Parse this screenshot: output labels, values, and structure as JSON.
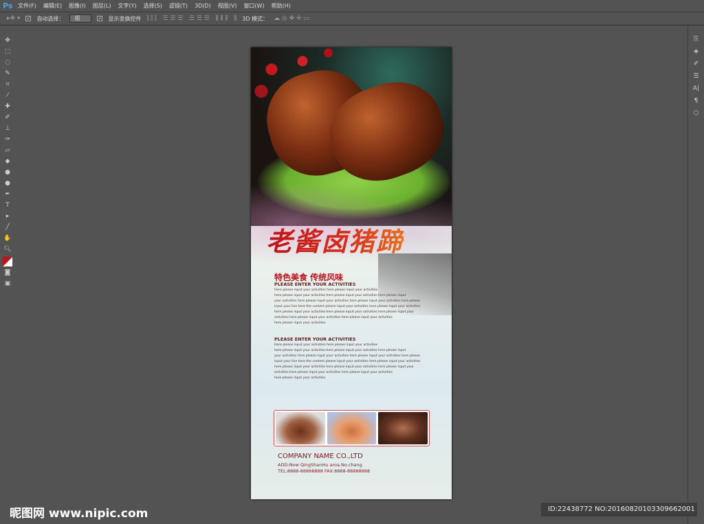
{
  "app": {
    "logo": "Ps"
  },
  "menu": [
    "文件(F)",
    "编辑(E)",
    "图像(I)",
    "图层(L)",
    "文字(Y)",
    "选择(S)",
    "滤镜(T)",
    "3D(D)",
    "视图(V)",
    "窗口(W)",
    "帮助(H)"
  ],
  "options": {
    "auto_select_label": "自动选择：",
    "auto_select_value": "组",
    "show_transform_label": "显示变换控件",
    "mode_3d_label": "3D 模式："
  },
  "poster": {
    "title": "老酱卤猪蹄",
    "subtitle": "特色美食 传统风味",
    "heading1": "PLEASE ENTER YOUR ACTIVITIES",
    "para1": [
      "Here please input your activities here please input your activities",
      "here please input your activities here please input your activities here please input",
      "your activities here please input your activities here please input your activities here please",
      "input your live here the content please input your activities here please input your activities",
      "here please input your activities here please input your activities here please input your",
      " activities here please input your activities here please input your activities",
      "here please input your activities"
    ],
    "heading2": "PLEASE ENTER YOUR ACTIVITIES",
    "para2": [
      "Here please input your activities here please input your activities",
      "here please input your activities here please input your activities here please input",
      "your activities here please input your activities here please input your activities here please",
      "input your live here the content please input your activities here please input your activities",
      "here please input your activities here please input your activities here please input your",
      " activities here please input your activities here please input your activities",
      "here please input your activities"
    ],
    "company": "COMPANY NAME CO.,LTD",
    "address": "ADD:Now QingShanHu aroa.No.chang",
    "tel": "TEL:8888-88888888  FAX:8888-88888888"
  },
  "watermark": "昵图网 www.nipic.com",
  "id_text": "ID:22438772 NO:20160820103309662001",
  "colors": {
    "accent": "#b8141c",
    "ui_bg": "#535353"
  }
}
